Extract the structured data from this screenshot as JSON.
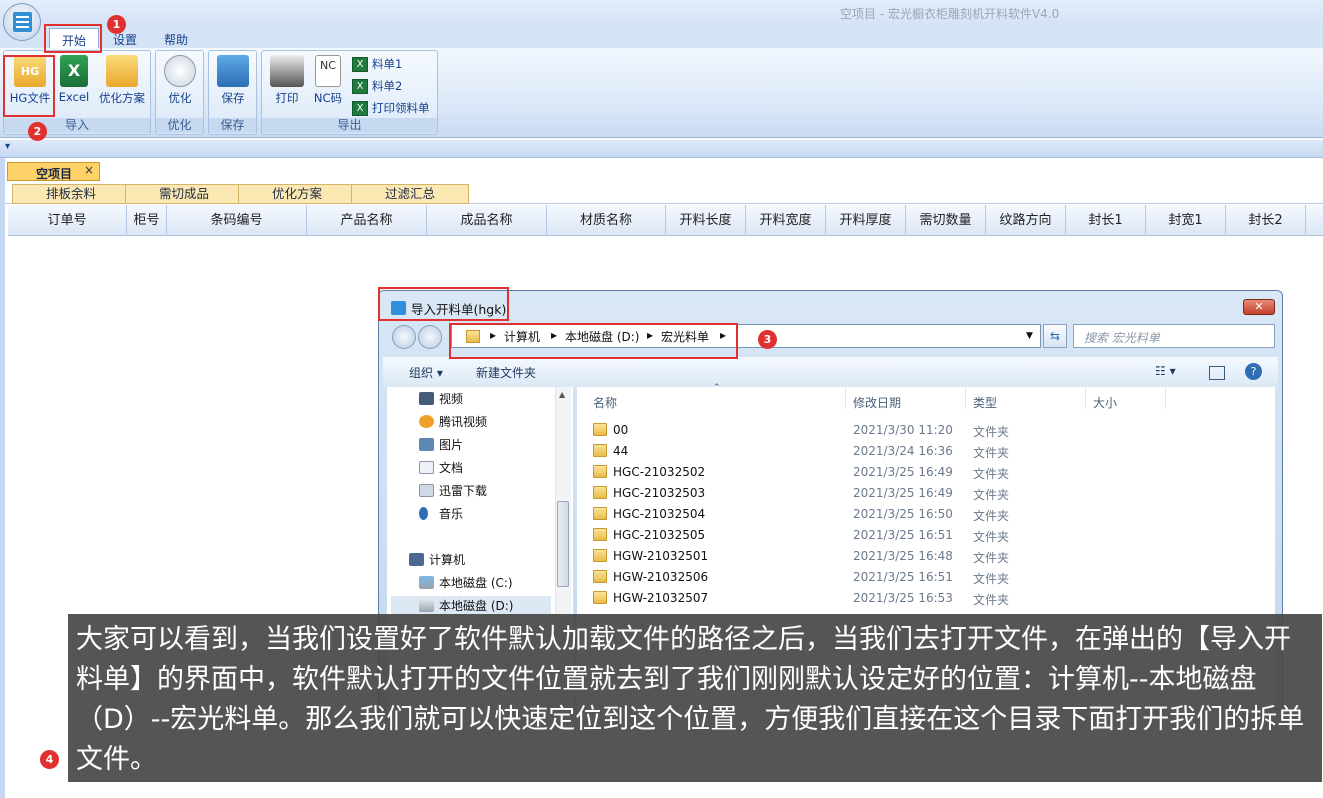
{
  "window": {
    "title": "空项目 - 宏光橱衣柜雕刻机开料软件V4.0"
  },
  "ribbon": {
    "tabs": [
      "开始",
      "设置",
      "帮助"
    ],
    "groups": {
      "import": {
        "label": "导入",
        "buttons": [
          "HG文件",
          "Excel",
          "优化方案"
        ]
      },
      "optimize": {
        "label": "优化",
        "buttons": [
          "优化"
        ]
      },
      "save": {
        "label": "保存",
        "buttons": [
          "保存"
        ]
      },
      "export": {
        "label": "导出",
        "buttons": [
          "打印",
          "NC码"
        ],
        "small": [
          "料单1",
          "料单2",
          "打印领料单"
        ]
      }
    }
  },
  "quickbar": {
    "arrow": "▾"
  },
  "document_tab": {
    "label": "空项目",
    "close": "×"
  },
  "sub_tabs": [
    "排板余料",
    "需切成品",
    "优化方案",
    "过滤汇总"
  ],
  "grid": {
    "columns": [
      "订单号",
      "柜号",
      "条码编号",
      "产品名称",
      "成品名称",
      "材质名称",
      "开料长度",
      "开料宽度",
      "开料厚度",
      "需切数量",
      "纹路方向",
      "封长1",
      "封宽1",
      "封长2"
    ]
  },
  "dialog": {
    "title": "导入开料单(hgk)",
    "close": "✕",
    "breadcrumb": [
      "计算机",
      "本地磁盘 (D:)",
      "宏光料单"
    ],
    "search_placeholder": "搜索 宏光料单",
    "toolbar": {
      "organize": "组织 ▾",
      "new_folder": "新建文件夹"
    },
    "nav_items": [
      {
        "label": "视频",
        "icon": "video-icon"
      },
      {
        "label": "腾讯视频",
        "icon": "tencent-video-icon"
      },
      {
        "label": "图片",
        "icon": "picture-icon"
      },
      {
        "label": "文档",
        "icon": "document-icon"
      },
      {
        "label": "迅雷下载",
        "icon": "download-icon"
      },
      {
        "label": "音乐",
        "icon": "music-icon"
      },
      {
        "label": "计算机",
        "icon": "computer-icon"
      },
      {
        "label": "本地磁盘 (C:)",
        "icon": "drive-c-icon"
      },
      {
        "label": "本地磁盘 (D:)",
        "icon": "drive-d-icon"
      }
    ],
    "file_headers": [
      "名称",
      "修改日期",
      "类型",
      "大小"
    ],
    "files": [
      {
        "name": "00",
        "date": "2021/3/30 11:20",
        "type": "文件夹"
      },
      {
        "name": "44",
        "date": "2021/3/24 16:36",
        "type": "文件夹"
      },
      {
        "name": "HGC-21032502",
        "date": "2021/3/25 16:49",
        "type": "文件夹"
      },
      {
        "name": "HGC-21032503",
        "date": "2021/3/25 16:49",
        "type": "文件夹"
      },
      {
        "name": "HGC-21032504",
        "date": "2021/3/25 16:50",
        "type": "文件夹"
      },
      {
        "name": "HGC-21032505",
        "date": "2021/3/25 16:51",
        "type": "文件夹"
      },
      {
        "name": "HGW-21032501",
        "date": "2021/3/25 16:48",
        "type": "文件夹"
      },
      {
        "name": "HGW-21032506",
        "date": "2021/3/25 16:51",
        "type": "文件夹"
      },
      {
        "name": "HGW-21032507",
        "date": "2021/3/25 16:53",
        "type": "文件夹"
      }
    ]
  },
  "annotations": {
    "markers": [
      "1",
      "2",
      "3",
      "4"
    ]
  },
  "caption": "大家可以看到，当我们设置好了软件默认加载文件的路径之后，当我们去打开文件，在弹出的【导入开料单】的界面中，软件默认打开的文件位置就去到了我们刚刚默认设定好的位置：计算机--本地磁盘（D）--宏光料单。那么我们就可以快速定位到这个位置，方便我们直接在这个目录下面打开我们的拆单文件。",
  "colors": {
    "annotation_red": "#e0302f",
    "ribbon_blue": "#d5e3f6",
    "tab_yellow": "#ffd36a"
  }
}
